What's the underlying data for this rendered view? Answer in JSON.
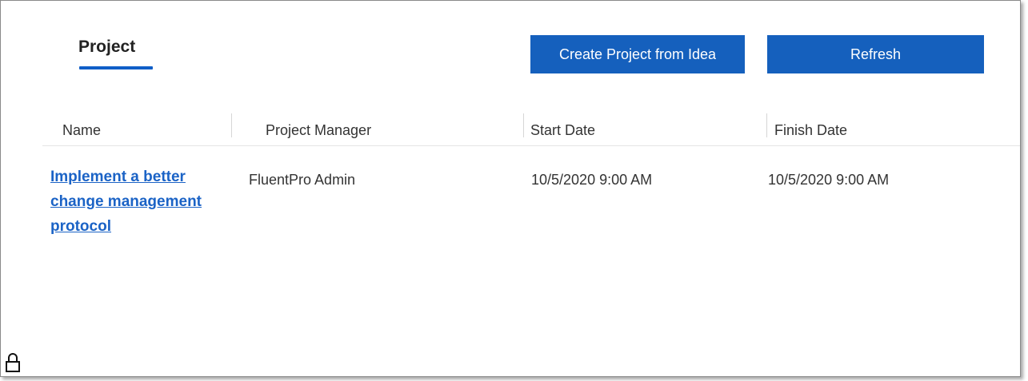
{
  "tabs": [
    {
      "label": "Project",
      "active": true
    }
  ],
  "toolbar": {
    "create_label": "Create Project from Idea",
    "refresh_label": "Refresh"
  },
  "table": {
    "columns": [
      "Name",
      "Project Manager",
      "Start Date",
      "Finish Date"
    ],
    "rows": [
      {
        "name": "Implement a better change management protocol",
        "manager": "FluentPro Admin",
        "start": "10/5/2020 9:00 AM",
        "finish": "10/5/2020 9:00 AM"
      }
    ]
  },
  "icons": {
    "lock": "lock-icon"
  },
  "colors": {
    "accent": "#1560bd",
    "link": "#1b63c6",
    "tab_underline": "#0f5ec7"
  }
}
